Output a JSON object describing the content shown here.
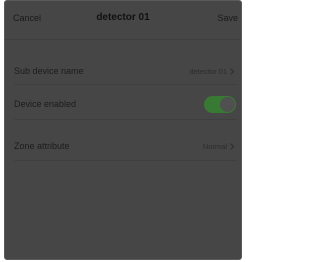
{
  "header": {
    "cancel_label": "Cancel",
    "title": "detector 01",
    "save_label": "Save"
  },
  "rows": [
    {
      "label": "Sub device name",
      "value": "detector 01"
    },
    {
      "label": "Device enabled",
      "toggle_on": true
    },
    {
      "label": "Zone attribute",
      "value": "Normal"
    }
  ],
  "colors": {
    "overlay": "#464646",
    "toggle_on": "#387a34"
  }
}
